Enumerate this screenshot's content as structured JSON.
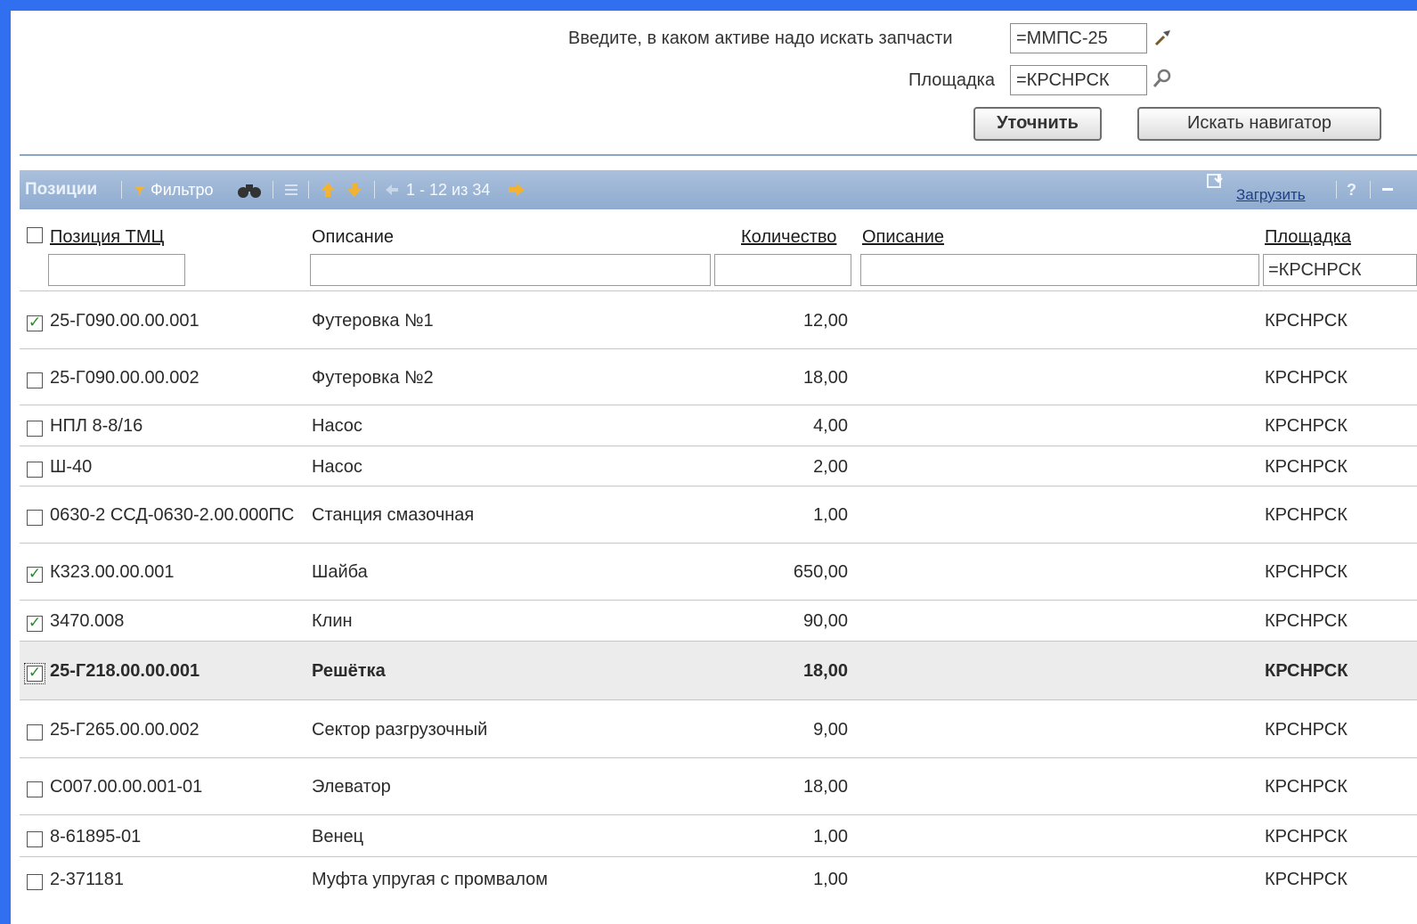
{
  "search": {
    "asset_label": "Введите, в каком активе надо искать запчасти",
    "asset_value": "=ММПС-25",
    "site_label": "Площадка",
    "site_value": "=КРСНРСК",
    "refine_button": "Уточнить",
    "navigator_button": "Искать навигатор"
  },
  "toolbar": {
    "title": "Позиции",
    "filter_label": "Фильтро",
    "pager_text": "1 - 12 из 34",
    "load_label": "Загрузить",
    "help_label": "?"
  },
  "columns": {
    "item": "Позиция ТМЦ",
    "desc1": "Описание",
    "qty": "Количество",
    "desc2": "Описание",
    "site": "Площадка"
  },
  "filters": {
    "site": "=КРСНРСК"
  },
  "rows": [
    {
      "checked": true,
      "item": "25-Г090.00.00.001",
      "desc": "Футеровка №1",
      "qty": "12,00",
      "site": "КРСНРСК"
    },
    {
      "checked": false,
      "item": "25-Г090.00.00.002",
      "desc": "Футеровка №2",
      "qty": "18,00",
      "site": "КРСНРСК"
    },
    {
      "checked": false,
      "item": "НПЛ 8-8/16",
      "desc": "Насос",
      "qty": "4,00",
      "site": "КРСНРСК"
    },
    {
      "checked": false,
      "item": "Ш-40",
      "desc": "Насос",
      "qty": "2,00",
      "site": "КРСНРСК"
    },
    {
      "checked": false,
      "item": "0630-2 ССД-0630-2.00.000ПС",
      "desc": "Станция смазочная",
      "qty": "1,00",
      "site": "КРСНРСК"
    },
    {
      "checked": true,
      "item": "К323.00.00.001",
      "desc": "Шайба",
      "qty": "650,00",
      "site": "КРСНРСК"
    },
    {
      "checked": true,
      "item": "3470.008",
      "desc": "Клин",
      "qty": "90,00",
      "site": "КРСНРСК"
    },
    {
      "checked": true,
      "item": "25-Г218.00.00.001",
      "desc": "Решётка",
      "qty": "18,00",
      "site": "КРСНРСК",
      "selected": true
    },
    {
      "checked": false,
      "item": "25-Г265.00.00.002",
      "desc": "Сектор разгрузочный",
      "qty": "9,00",
      "site": "КРСНРСК"
    },
    {
      "checked": false,
      "item": "С007.00.00.001-01",
      "desc": "Элеватор",
      "qty": "18,00",
      "site": "КРСНРСК"
    },
    {
      "checked": false,
      "item": "8-61895-01",
      "desc": "Венец",
      "qty": "1,00",
      "site": "КРСНРСК"
    },
    {
      "checked": false,
      "item": "2-371181",
      "desc": "Муфта упругая с промвалом",
      "qty": "1,00",
      "site": "КРСНРСК"
    }
  ],
  "colors": {
    "frame": "#2f6ff0",
    "toolbar": "#9bb5d6",
    "selected_row": "#ececec",
    "check": "#2a8a2a"
  }
}
